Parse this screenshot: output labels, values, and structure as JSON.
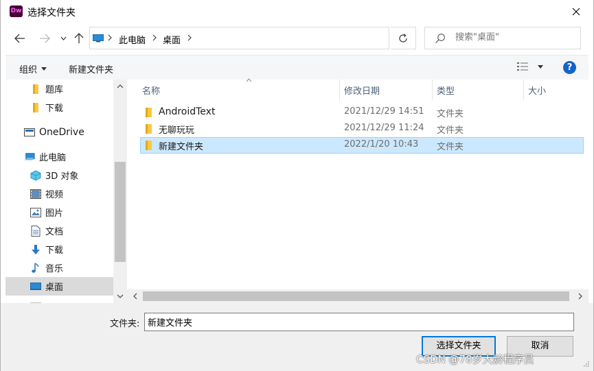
{
  "window": {
    "app_logo_text": "Dw",
    "title": "选择文件夹"
  },
  "address_bar": {
    "crumbs": [
      "此电脑",
      "桌面"
    ]
  },
  "search": {
    "placeholder": "搜索\"桌面\""
  },
  "command_bar": {
    "organize_label": "组织",
    "new_folder_label": "新建文件夹"
  },
  "nav_pane": {
    "items": [
      {
        "label": "题库",
        "icon": "folder-icon"
      },
      {
        "label": "下载",
        "icon": "folder-icon"
      },
      {
        "label": "OneDrive",
        "icon": "onedrive-icon"
      },
      {
        "label": "此电脑",
        "icon": "computer-icon"
      },
      {
        "label": "3D 对象",
        "icon": "3d-objects-icon"
      },
      {
        "label": "视频",
        "icon": "video-icon"
      },
      {
        "label": "图片",
        "icon": "picture-icon"
      },
      {
        "label": "文档",
        "icon": "document-icon"
      },
      {
        "label": "下载",
        "icon": "download-icon"
      },
      {
        "label": "音乐",
        "icon": "music-icon"
      },
      {
        "label": "桌面",
        "icon": "desktop-icon",
        "selected": true
      }
    ]
  },
  "file_list": {
    "columns": [
      "名称",
      "修改日期",
      "类型",
      "大小"
    ],
    "rows": [
      {
        "name": "AndroidText",
        "date": "2021/12/29 14:51",
        "type": "文件夹",
        "size": ""
      },
      {
        "name": "无聊玩玩",
        "date": "2021/12/29 11:24",
        "type": "文件夹",
        "size": ""
      },
      {
        "name": "新建文件夹",
        "date": "2022/1/20 10:43",
        "type": "文件夹",
        "size": "",
        "selected": true
      }
    ]
  },
  "bottom": {
    "folder_label": "文件夹:",
    "folder_value": "新建文件夹",
    "select_button": "选择文件夹",
    "cancel_button": "取消"
  },
  "watermark": "CSDN @78岁大龄程序员",
  "colors": {
    "accent": "#0078d7",
    "selection_bg": "#cce8ff",
    "folder_yellow": "#f8c846",
    "help_blue": "#1464c8"
  }
}
